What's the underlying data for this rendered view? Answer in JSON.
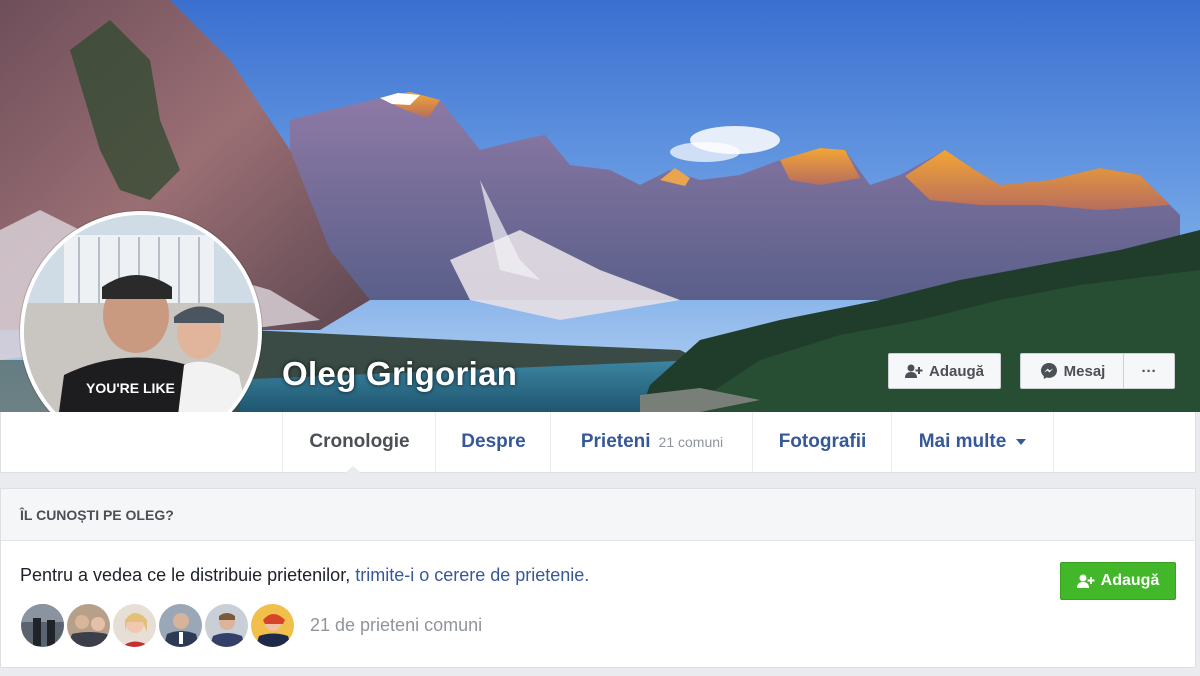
{
  "profile": {
    "name": "Oleg Grigorian"
  },
  "actions": {
    "add_label": "Adaugă",
    "message_label": "Mesaj",
    "more_label": "···"
  },
  "tabs": [
    {
      "label": "Cronologie",
      "active": true
    },
    {
      "label": "Despre"
    },
    {
      "label": "Prieteni",
      "count": "21 comuni"
    },
    {
      "label": "Fotografii"
    },
    {
      "label": "Mai multe"
    }
  ],
  "know_card": {
    "header": "ÎL CUNOȘTI PE OLEG?",
    "text_prefix": "Pentru a vedea ce le distribuie prietenilor, ",
    "link_text": "trimite-i o cerere de prietenie.",
    "add_label": "Adaugă",
    "mutual_text": "21 de prieteni comuni",
    "mutual_avatar_count": 6
  },
  "colors": {
    "link": "#365899",
    "green_button": "#42b72a",
    "sky_top": "#3a6fd0"
  }
}
